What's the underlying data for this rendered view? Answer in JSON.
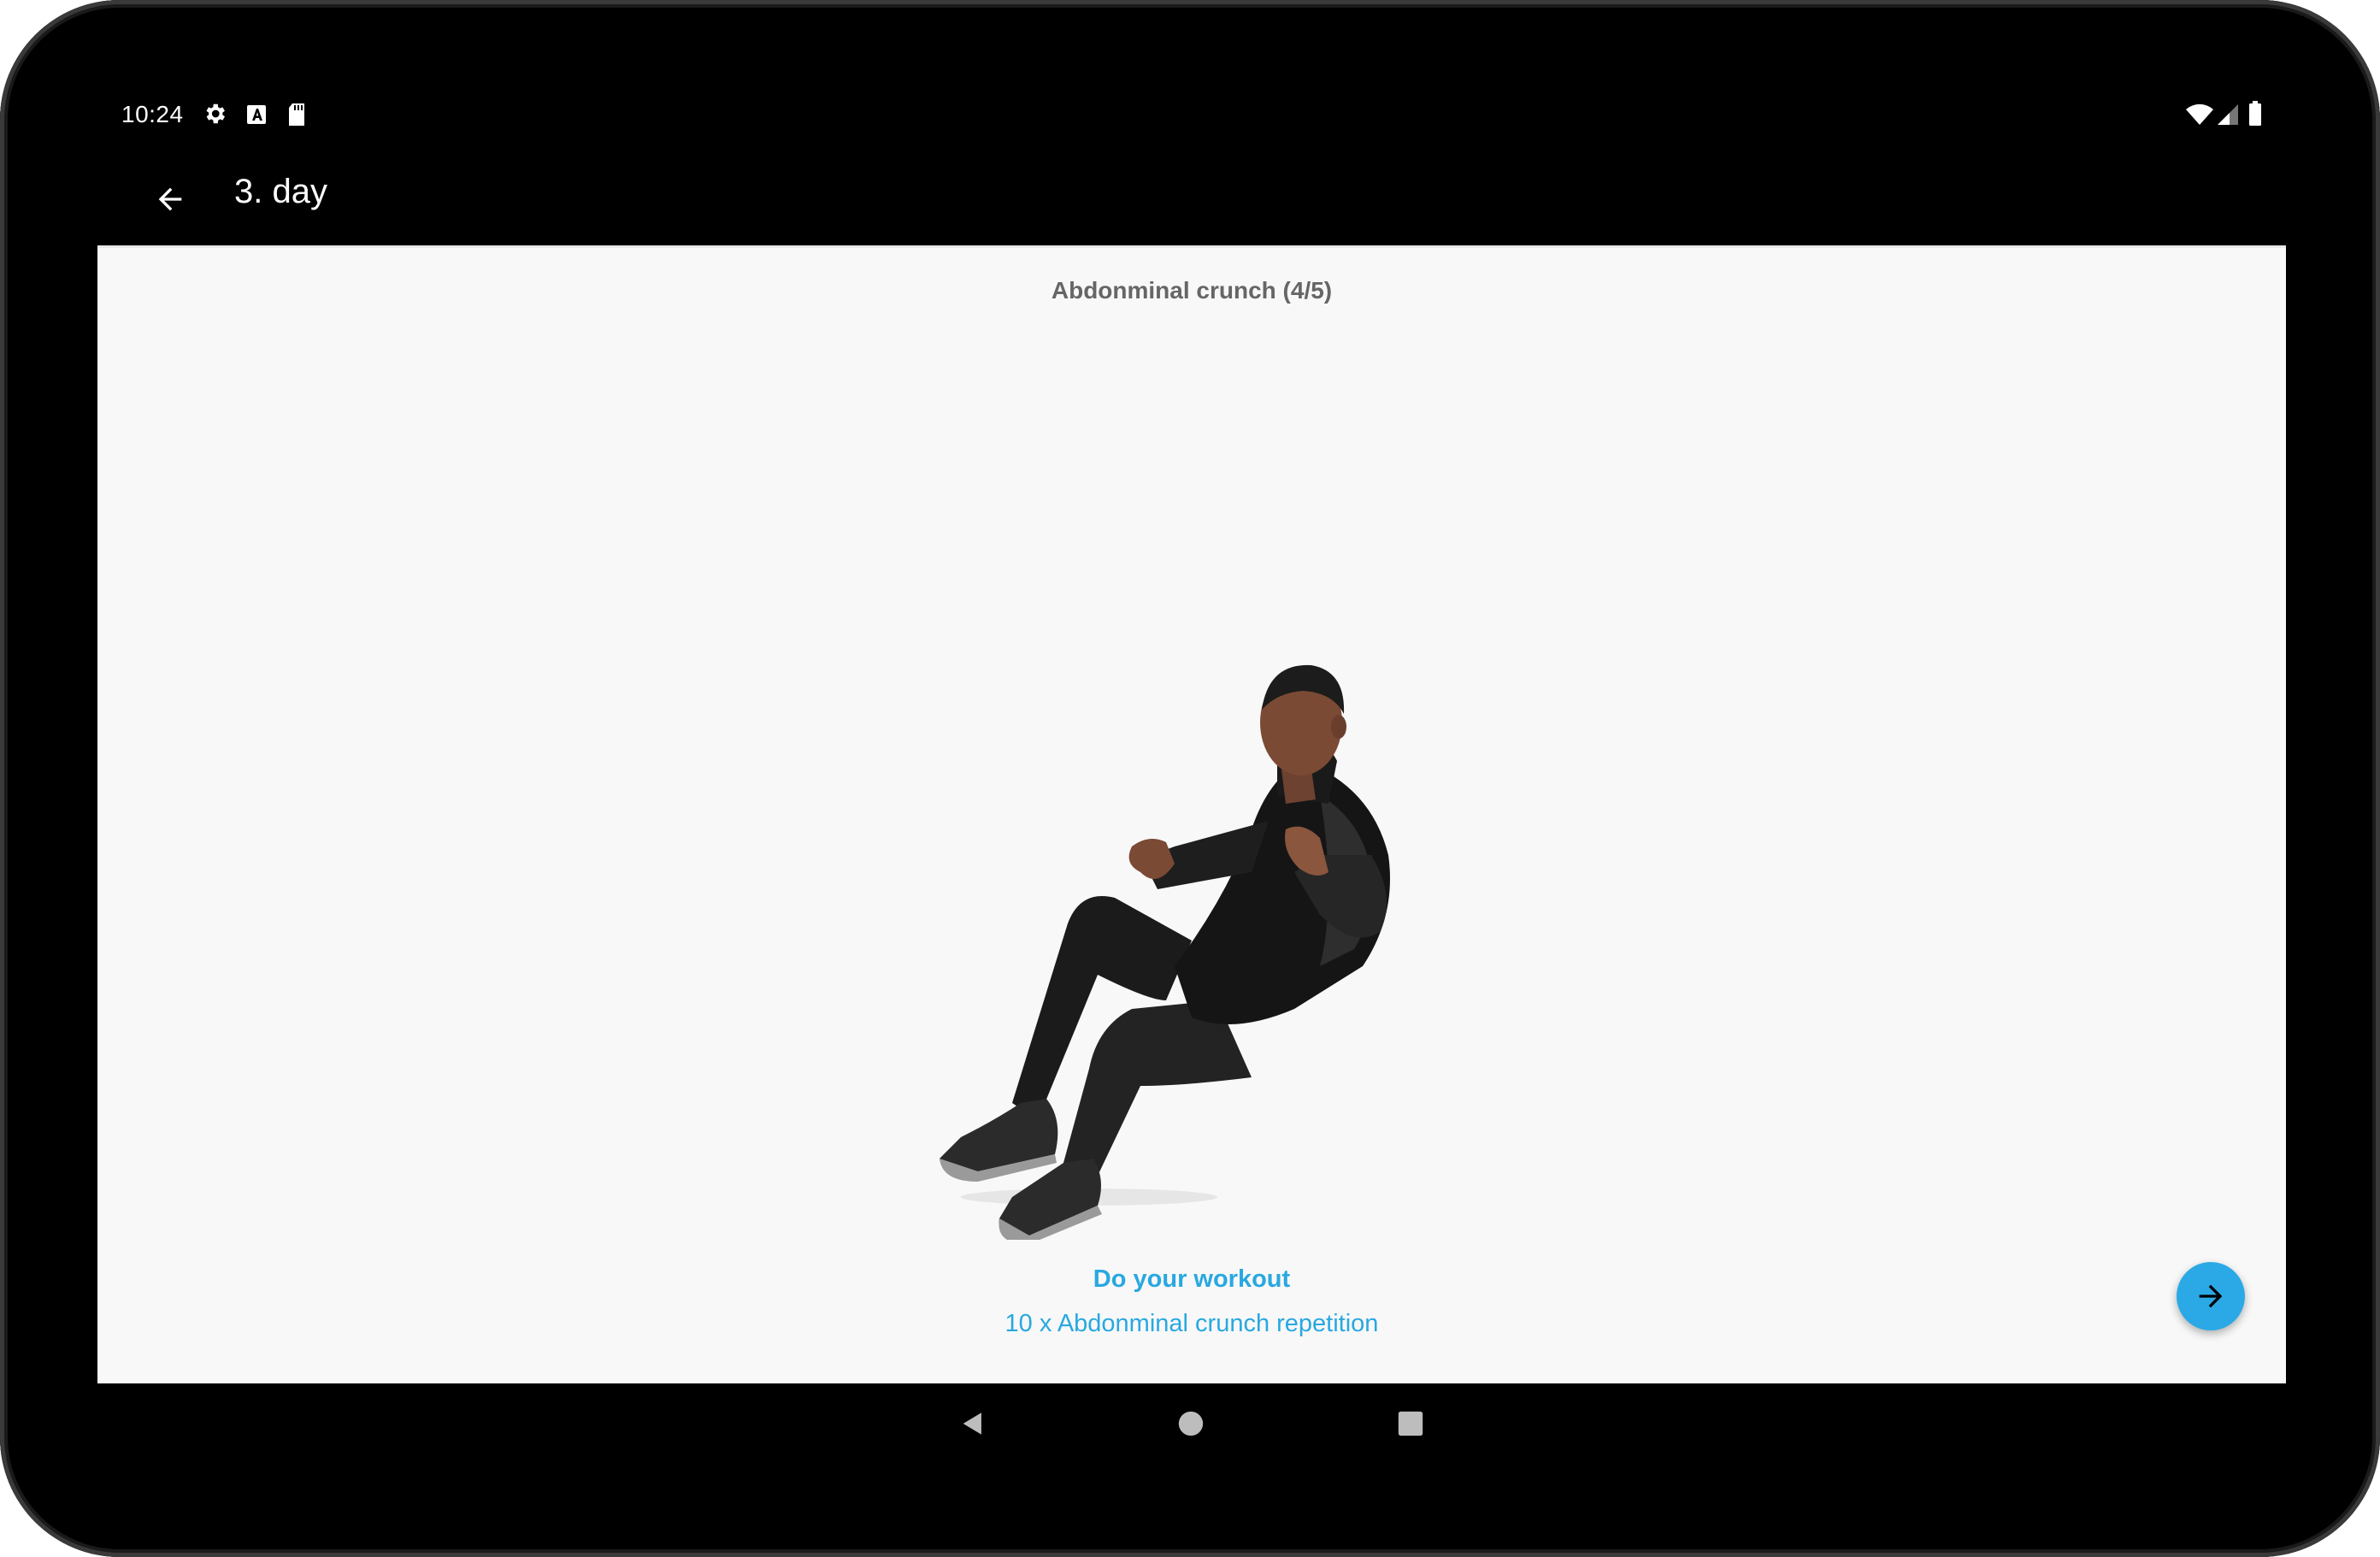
{
  "status_bar": {
    "time": "10:24",
    "left_icons": [
      "gear-icon",
      "a-icon",
      "sd-card-icon"
    ],
    "right_icons": [
      "wifi-icon",
      "signal-icon",
      "battery-icon"
    ]
  },
  "app_bar": {
    "back_icon": "arrow-back-icon",
    "title": "3. day"
  },
  "exercise": {
    "name": "Abdonminal crunch (4/5)",
    "instruction_title": "Do your workout",
    "instruction_detail": "10 x Abdonminal crunch repetition"
  },
  "fab": {
    "icon": "arrow-forward-icon"
  },
  "navigation_bar": {
    "buttons": [
      "back-triangle-icon",
      "home-circle-icon",
      "recents-square-icon"
    ]
  },
  "colors": {
    "accent": "#29a8e0",
    "background": "#f8f8f8",
    "bezel": "#000000"
  }
}
